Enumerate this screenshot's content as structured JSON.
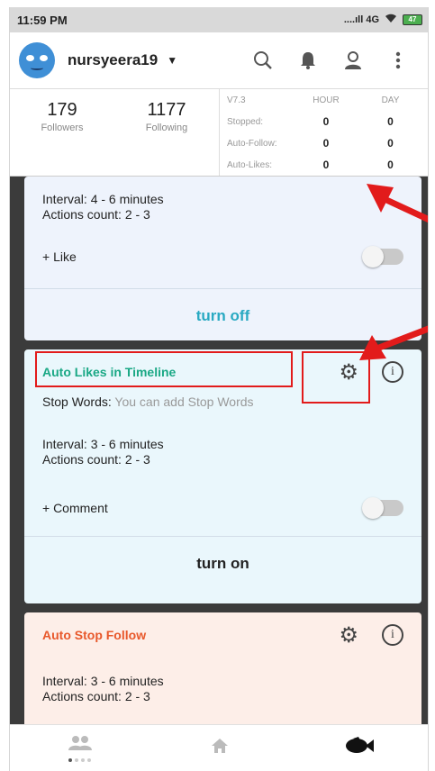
{
  "status_bar": {
    "time": "11:59 PM",
    "network": "....ıll 4G",
    "battery": "47"
  },
  "app_bar": {
    "username": "nursyeera19",
    "icons": [
      "search-icon",
      "bell-icon",
      "user-icon",
      "more-icon"
    ]
  },
  "profile_stats": {
    "followers_count": "179",
    "followers_label": "Followers",
    "following_count": "1177",
    "following_label": "Following"
  },
  "stats_table": {
    "version": "V7.3",
    "hour_label": "HOUR",
    "day_label": "DAY",
    "rows": [
      {
        "label": "Stopped:",
        "hour": "0",
        "day": "0"
      },
      {
        "label": "Auto-Follow:",
        "hour": "0",
        "day": "0"
      },
      {
        "label": "Auto-Likes:",
        "hour": "0",
        "day": "0"
      }
    ]
  },
  "cards": [
    {
      "interval": "Interval: 4 - 6 minutes",
      "actions": "Actions count: 2 - 3",
      "option_label": "+ Like",
      "option_on": false,
      "action_label": "turn off",
      "action_color": "#29a9c2"
    },
    {
      "title": "Auto Likes in Timeline",
      "title_color": "#1aa885",
      "stop_words_label": "Stop Words:",
      "stop_words_placeholder": "You can add Stop Words",
      "interval": "Interval: 3 - 6 minutes",
      "actions": "Actions count: 2 - 3",
      "option_label": "+ Comment",
      "option_on": false,
      "action_label": "turn on",
      "action_color": "#222222"
    },
    {
      "title": "Auto Stop Follow",
      "title_color": "#e8582b",
      "interval": "Interval: 3 - 6 minutes",
      "actions": "Actions count: 2 - 3"
    }
  ],
  "bottom_nav": {
    "tabs": [
      "people-icon",
      "home-icon",
      "fish-icon"
    ],
    "page_count": 4,
    "active_page": 1
  },
  "colors": {
    "annotation": "#e21b1b",
    "background": "#3b3b3b"
  }
}
